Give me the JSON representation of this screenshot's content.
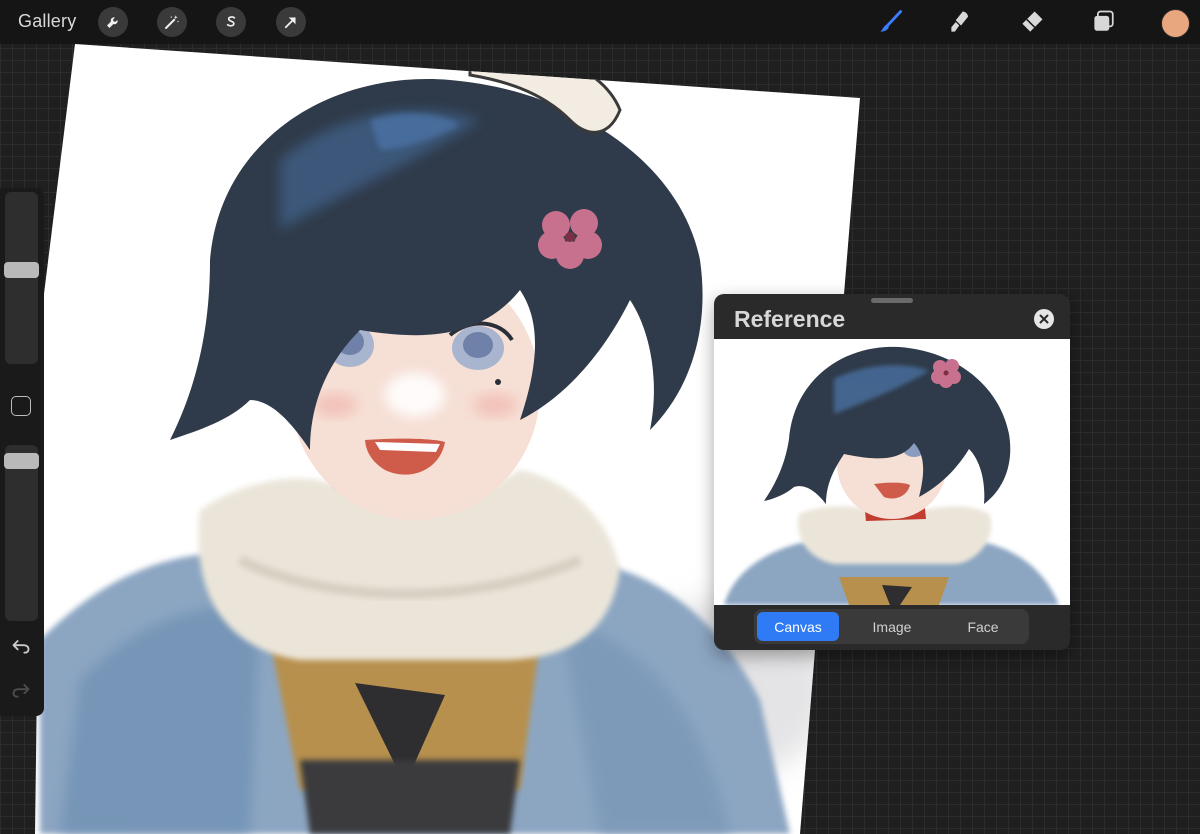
{
  "topbar": {
    "gallery_label": "Gallery",
    "left_tools": [
      {
        "icon": "wrench-icon"
      },
      {
        "icon": "magic-wand-icon"
      },
      {
        "icon": "selection-s-icon"
      },
      {
        "icon": "arrow-transform-icon"
      }
    ],
    "right_tools": [
      {
        "icon": "brush-icon",
        "active": true
      },
      {
        "icon": "smudge-icon"
      },
      {
        "icon": "eraser-icon"
      },
      {
        "icon": "layers-icon"
      }
    ],
    "current_color": "#e8a77e"
  },
  "colors": {
    "accent": "#2f7bf5",
    "brush_active": "#3c7dff"
  },
  "sidebar": {
    "size_slider_level": 0.55,
    "opacity_slider_level": 0.95,
    "modify_button_icon": "square-icon",
    "undo_icon": "undo-icon",
    "redo_icon": "redo-icon"
  },
  "reference": {
    "title": "Reference",
    "close_icon": "close-icon",
    "tabs": [
      {
        "label": "Canvas",
        "active": true
      },
      {
        "label": "Image",
        "active": false
      },
      {
        "label": "Face",
        "active": false
      }
    ]
  }
}
